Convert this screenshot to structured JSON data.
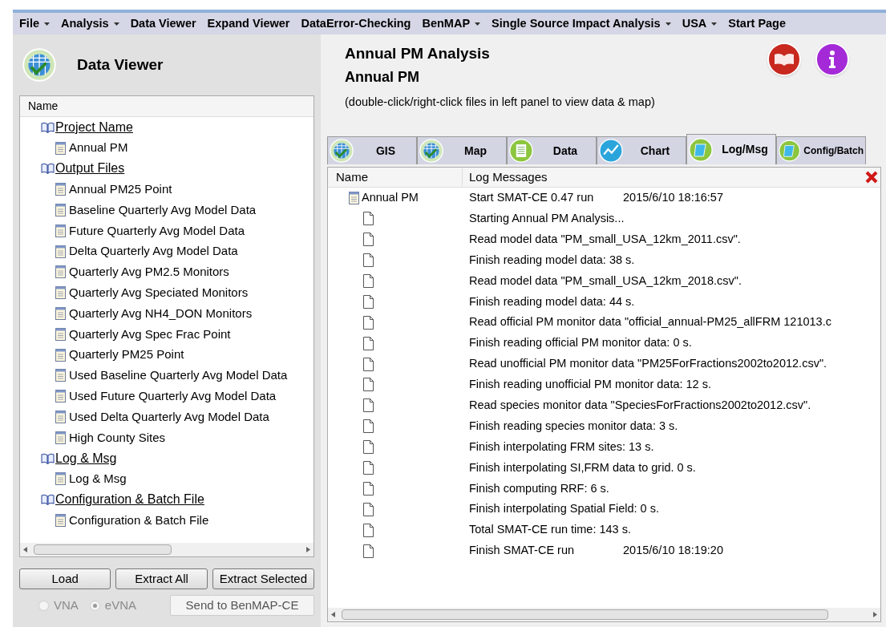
{
  "menu": [
    {
      "label": "File",
      "has_menu": true
    },
    {
      "label": "Analysis",
      "has_menu": true
    },
    {
      "label": "Data Viewer",
      "has_menu": false
    },
    {
      "label": "Expand Viewer",
      "has_menu": false
    },
    {
      "label": "DataError-Checking",
      "has_menu": false
    },
    {
      "label": "BenMAP",
      "has_menu": true
    },
    {
      "label": "Single Source Impact Analysis",
      "has_menu": true
    },
    {
      "label": "USA",
      "has_menu": true
    },
    {
      "label": "Start Page",
      "has_menu": false
    }
  ],
  "sidebar": {
    "title": "Data Viewer",
    "column": "Name",
    "tree": [
      {
        "label": "Project Name",
        "children": [
          {
            "label": "Annual PM"
          }
        ]
      },
      {
        "label": "Output Files",
        "children": [
          {
            "label": "Annual PM25 Point"
          },
          {
            "label": "Baseline Quarterly Avg Model Data"
          },
          {
            "label": "Future Quarterly Avg Model Data"
          },
          {
            "label": "Delta Quarterly Avg Model Data"
          },
          {
            "label": "Quarterly Avg PM2.5 Monitors"
          },
          {
            "label": "Quarterly Avg Speciated Monitors"
          },
          {
            "label": "Quarterly Avg NH4_DON Monitors"
          },
          {
            "label": "Quarterly Avg Spec Frac Point"
          },
          {
            "label": "Quarterly PM25 Point"
          },
          {
            "label": "Used Baseline Quarterly Avg Model Data"
          },
          {
            "label": "Used Future Quarterly Avg Model Data"
          },
          {
            "label": "Used Delta Quarterly Avg Model Data"
          },
          {
            "label": "High County Sites"
          }
        ]
      },
      {
        "label": "Log & Msg",
        "children": [
          {
            "label": "Log & Msg"
          }
        ]
      },
      {
        "label": "Configuration & Batch File",
        "children": [
          {
            "label": "Configuration & Batch File"
          }
        ]
      }
    ],
    "buttons": [
      "Load",
      "Extract All",
      "Extract Selected"
    ],
    "radios": [
      {
        "label": "VNA",
        "selected": false
      },
      {
        "label": "eVNA",
        "selected": true
      }
    ],
    "radios_disabled": true,
    "send_button": {
      "label": "Send to BenMAP-CE",
      "disabled": true
    }
  },
  "header": {
    "title": "Annual PM Analysis",
    "subtitle": "Annual PM",
    "hint": "(double-click/right-click files in left panel to view data & map)"
  },
  "tabs": [
    {
      "label": "GIS",
      "kind": "globe",
      "selected": false
    },
    {
      "label": "Map",
      "kind": "globe",
      "selected": false
    },
    {
      "label": "Data",
      "kind": "sheet",
      "selected": false
    },
    {
      "label": "Chart",
      "kind": "chart",
      "selected": false
    },
    {
      "label": "Log/Msg",
      "kind": "note",
      "selected": true
    },
    {
      "label": "Config/Batch",
      "kind": "note",
      "selected": false
    }
  ],
  "log": {
    "columns": [
      "Name",
      "Log Messages"
    ],
    "rows": [
      {
        "kind": "file",
        "name": "Annual PM",
        "message": "Start SMAT-CE 0.47 run",
        "time": "2015/6/10 18:16:57"
      },
      {
        "kind": "entry",
        "message": "Starting Annual PM Analysis..."
      },
      {
        "kind": "entry",
        "message": "Read model data \"PM_small_USA_12km_2011.csv\"."
      },
      {
        "kind": "entry",
        "message": "Finish reading model data: 38 s."
      },
      {
        "kind": "entry",
        "message": "Read model data \"PM_small_USA_12km_2018.csv\"."
      },
      {
        "kind": "entry",
        "message": "Finish reading model data: 44 s."
      },
      {
        "kind": "entry",
        "message": "Read official PM monitor data \"official_annual-PM25_allFRM 121013.c"
      },
      {
        "kind": "entry",
        "message": "Finish reading official PM monitor data: 0 s."
      },
      {
        "kind": "entry",
        "message": "Read unofficial PM monitor data \"PM25ForFractions2002to2012.csv\"."
      },
      {
        "kind": "entry",
        "message": "Finish reading unofficial PM monitor data: 12 s."
      },
      {
        "kind": "entry",
        "message": "Read species monitor data \"SpeciesForFractions2002to2012.csv\"."
      },
      {
        "kind": "entry",
        "message": "Finish reading species monitor data: 3 s."
      },
      {
        "kind": "entry",
        "message": "Finish interpolating FRM sites: 13 s."
      },
      {
        "kind": "entry",
        "message": "Finish interpolating SI,FRM data to grid. 0 s."
      },
      {
        "kind": "entry",
        "message": "Finish computing RRF: 6 s."
      },
      {
        "kind": "entry",
        "message": "Finish interpolating Spatial Field: 0 s."
      },
      {
        "kind": "entry",
        "message": "Total SMAT-CE run time: 143 s."
      },
      {
        "kind": "entry",
        "message": "Finish SMAT-CE run",
        "time": "2015/6/10 18:19:20"
      }
    ]
  }
}
